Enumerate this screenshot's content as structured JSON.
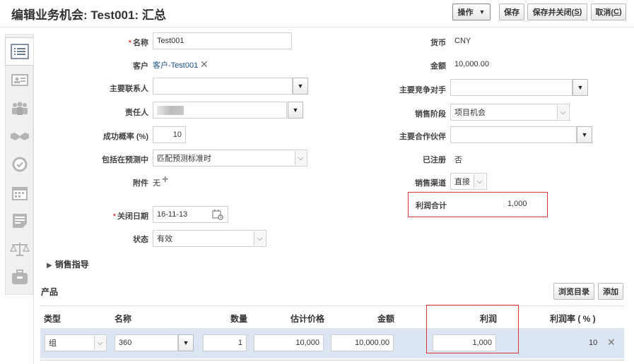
{
  "header": {
    "title": "编辑业务机会: Test001: 汇总",
    "actions_label": "操作",
    "save_label": "保存",
    "save_close_label": "保存并关闭(",
    "save_close_key": "S",
    "save_close_end": ")",
    "cancel_label": "取消(",
    "cancel_key": "C",
    "cancel_end": ")"
  },
  "rail": {
    "icons": [
      "summary-list-icon",
      "contact-card-icon",
      "team-icon",
      "handshake-icon",
      "checkmark-badge-icon",
      "calendar-icon",
      "note-icon",
      "scales-icon",
      "briefcase-icon"
    ]
  },
  "form_left": {
    "name_label": "名称",
    "name_value": "Test001",
    "customer_label": "客户",
    "customer_value": "客户-Test001",
    "primary_contact_label": "主要联系人",
    "primary_contact_value": "",
    "owner_label": "责任人",
    "win_prob_label": "成功概率 (%)",
    "win_prob_value": "10",
    "forecast_label": "包括在预测中",
    "forecast_value": "匹配预测标准时",
    "attach_label": "附件",
    "attach_value": "无",
    "close_date_label": "关闭日期",
    "close_date_value": "16-11-13",
    "status_label": "状态",
    "status_value": "有效"
  },
  "form_right": {
    "currency_label": "货币",
    "currency_value": "CNY",
    "amount_label": "金额",
    "amount_value": "10,000.00",
    "competitor_label": "主要竞争对手",
    "competitor_value": "",
    "sales_stage_label": "销售阶段",
    "sales_stage_value": "项目机会",
    "partner_label": "主要合作伙伴",
    "partner_value": "",
    "registered_label": "已注册",
    "registered_value": "否",
    "channel_label": "销售渠道",
    "channel_value": "直接",
    "profit_total_label": "利润合计",
    "profit_total_value": "1,000"
  },
  "sales_guide": {
    "label": "销售指导"
  },
  "products": {
    "title": "产品",
    "browse_label": "浏览目录",
    "add_label": "添加",
    "columns": [
      "类型",
      "名称",
      "数量",
      "估计价格",
      "金额",
      "利润",
      "利润率 ( % )"
    ],
    "rows": [
      {
        "type": "组",
        "name": "360",
        "qty": "1",
        "est_price": "10,000",
        "amount": "10,000.00",
        "profit": "1,000",
        "margin": "10"
      }
    ]
  }
}
